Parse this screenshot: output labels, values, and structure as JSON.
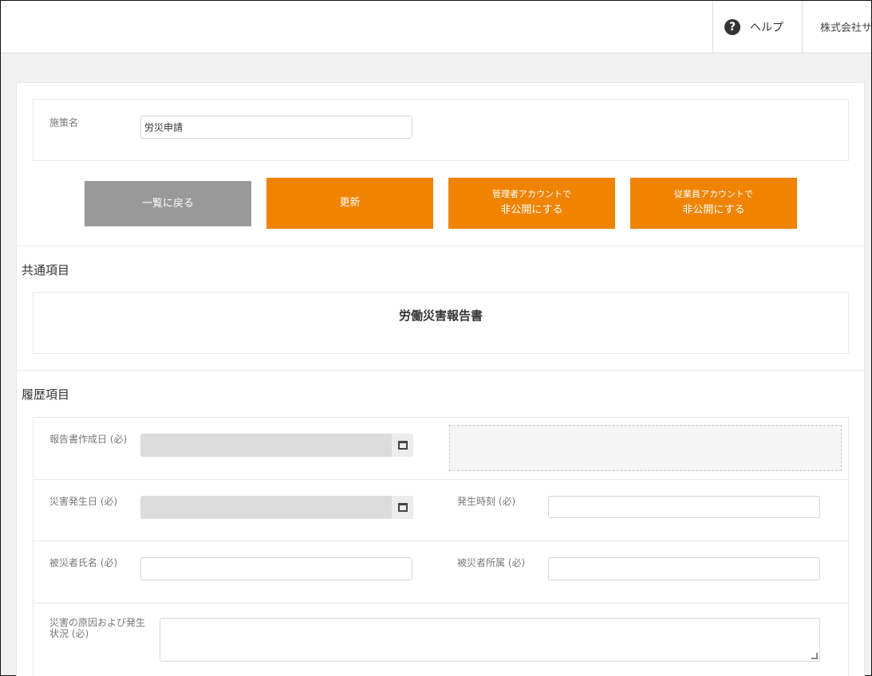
{
  "header": {
    "help_label": "ヘルプ",
    "help_icon": "?",
    "company_label": "株式会社サ"
  },
  "policy": {
    "name_label": "施策名",
    "name_value": "労災申請"
  },
  "actions": {
    "back_label": "一覧に戻る",
    "update_label": "更新",
    "hide_admin_line1": "管理者アカウントで",
    "hide_admin_line2": "非公開にする",
    "hide_employee_line1": "従業員アカウントで",
    "hide_employee_line2": "非公開にする"
  },
  "common": {
    "title": "共通項目",
    "report_title": "労働災害報告書"
  },
  "history": {
    "title": "履歴項目",
    "fields": {
      "report_date_label": "報告書作成日 (必)",
      "incident_date_label": "災害発生日 (必)",
      "incident_time_label": "発生時刻 (必)",
      "victim_name_label": "被災者氏名 (必)",
      "victim_dept_label": "被災者所属 (必)",
      "cause_label_line1": "災害の原因および発生",
      "cause_label_line2": "状況 (必)"
    }
  },
  "colors": {
    "accent": "#f08300",
    "back_button": "#999999"
  }
}
